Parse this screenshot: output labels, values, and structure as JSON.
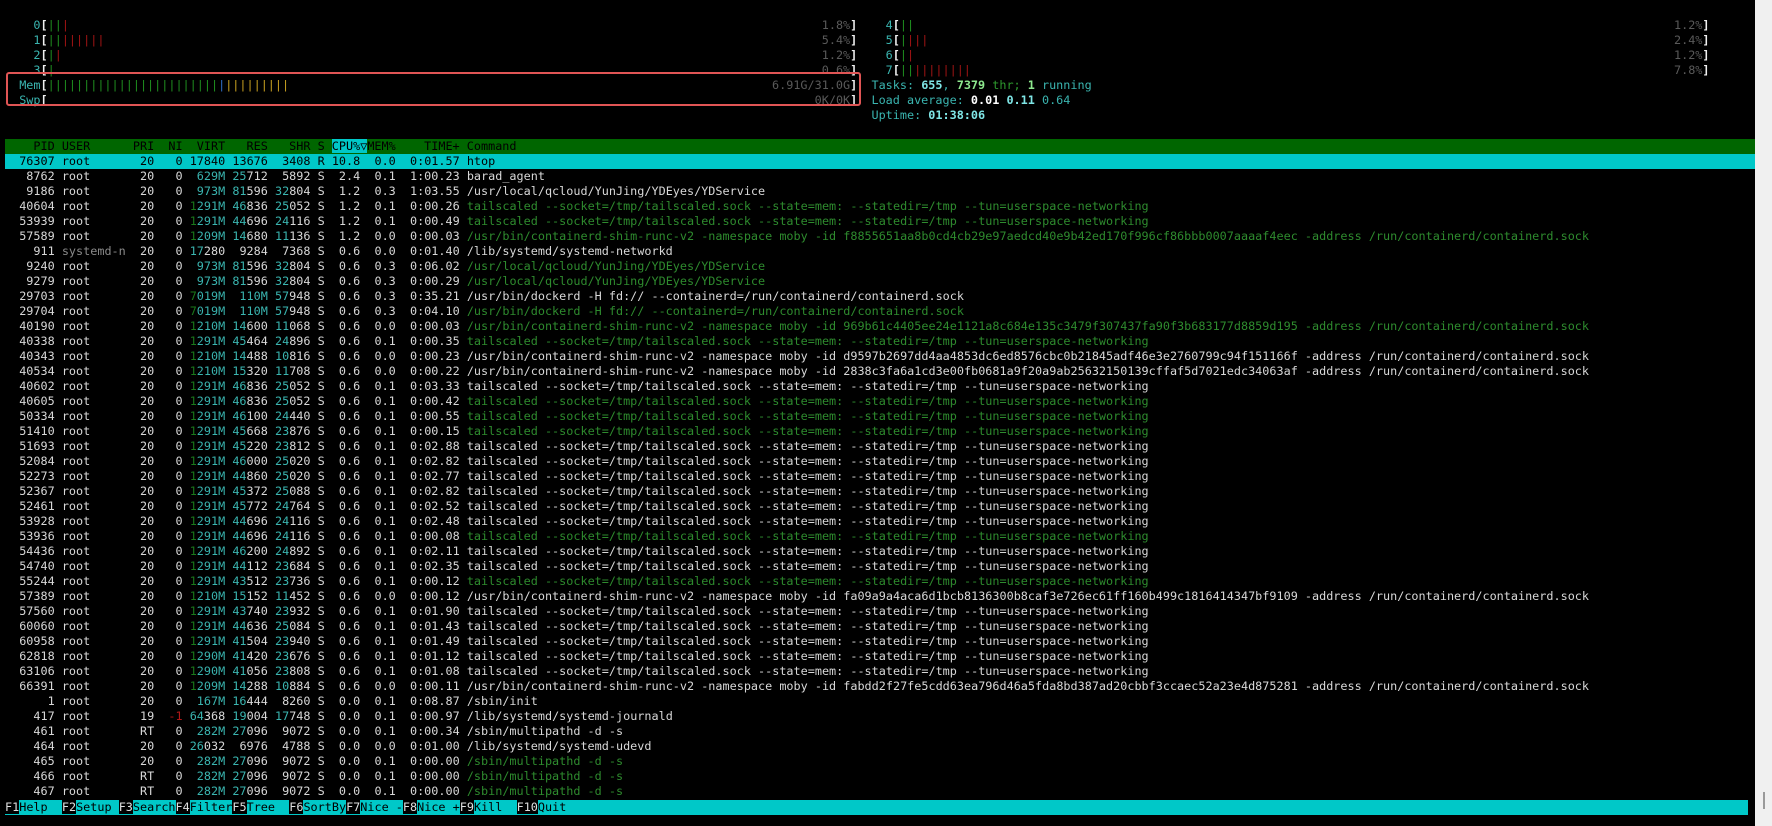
{
  "colors": {
    "header_bg": "#006600",
    "selected_bg": "#00c8c8",
    "bar_low": "#1f8f1f",
    "bar_kernel": "#a01414",
    "bar_buffers": "#3070c8",
    "bar_cache": "#c8a020",
    "thread": "#2e8b2e",
    "highlight_box": "#e05555"
  },
  "meters": {
    "left": [
      {
        "label": "0",
        "value": "1.8%",
        "percent": 1.8,
        "segments": [
          [
            "g",
            2
          ],
          [
            "r",
            1
          ]
        ]
      },
      {
        "label": "1",
        "value": "5.4%",
        "percent": 5.4,
        "segments": [
          [
            "g",
            2
          ],
          [
            "r",
            6
          ]
        ]
      },
      {
        "label": "2",
        "value": "1.2%",
        "percent": 1.2,
        "segments": [
          [
            "g",
            1
          ],
          [
            "r",
            1
          ]
        ]
      },
      {
        "label": "3",
        "value": "0.6%",
        "percent": 0.6,
        "segments": [
          [
            "g",
            1
          ]
        ]
      },
      {
        "label": "Mem",
        "value": "6.91G/31.0G",
        "segments": [
          [
            "g",
            24
          ],
          [
            "b",
            1
          ],
          [
            "y",
            9
          ]
        ]
      },
      {
        "label": "Swp",
        "value": "0K/0K",
        "segments": []
      }
    ],
    "right": [
      {
        "label": "4",
        "value": "1.2%",
        "percent": 1.2,
        "segments": [
          [
            "g",
            2
          ]
        ]
      },
      {
        "label": "5",
        "value": "2.4%",
        "percent": 2.4,
        "segments": [
          [
            "g",
            1
          ],
          [
            "r",
            3
          ]
        ]
      },
      {
        "label": "6",
        "value": "1.2%",
        "percent": 1.2,
        "segments": [
          [
            "g",
            1
          ],
          [
            "r",
            1
          ]
        ]
      },
      {
        "label": "7",
        "value": "7.8%",
        "percent": 7.8,
        "segments": [
          [
            "g",
            2
          ],
          [
            "r",
            8
          ]
        ]
      }
    ]
  },
  "summary": {
    "tasks_label": "Tasks: ",
    "tasks": "655",
    "sep": ", ",
    "threads": "7379",
    "thr_label": " thr; ",
    "running": "1",
    "running_label": " running",
    "load_label": "Load average: ",
    "load1": "0.01",
    "load5": "0.11",
    "load15": "0.64",
    "uptime_label": "Uptime: ",
    "uptime": "01:38:06"
  },
  "table": {
    "columns": [
      "PID",
      "USER",
      "PRI",
      "NI",
      "VIRT",
      "RES",
      "SHR",
      "S",
      "CPU%▽",
      "MEM%",
      "TIME+",
      "Command"
    ],
    "sort_column": "CPU%▽",
    "selected_pid": "76307",
    "rows": [
      [
        "76307",
        "root",
        "20",
        "0",
        "17840",
        "13676",
        "3408",
        "R",
        "10.8",
        "0.0",
        "0:01.57",
        "htop",
        false
      ],
      [
        "8762",
        "root",
        "20",
        "0",
        "629M",
        "25712",
        "5892",
        "S",
        "2.4",
        "0.1",
        "1:00.23",
        "barad_agent",
        false
      ],
      [
        "9186",
        "root",
        "20",
        "0",
        "973M",
        "81596",
        "32804",
        "S",
        "1.2",
        "0.3",
        "1:03.55",
        "/usr/local/qcloud/YunJing/YDEyes/YDService",
        false
      ],
      [
        "40604",
        "root",
        "20",
        "0",
        "1291M",
        "46836",
        "25052",
        "S",
        "1.2",
        "0.1",
        "0:00.26",
        "tailscaled --socket=/tmp/tailscaled.sock --state=mem: --statedir=/tmp --tun=userspace-networking",
        true
      ],
      [
        "53939",
        "root",
        "20",
        "0",
        "1291M",
        "44696",
        "24116",
        "S",
        "1.2",
        "0.1",
        "0:00.49",
        "tailscaled --socket=/tmp/tailscaled.sock --state=mem: --statedir=/tmp --tun=userspace-networking",
        true
      ],
      [
        "57589",
        "root",
        "20",
        "0",
        "1209M",
        "14680",
        "11136",
        "S",
        "1.2",
        "0.0",
        "0:00.03",
        "/usr/bin/containerd-shim-runc-v2 -namespace moby -id f8855651aa8b0cd4cb29e97aedcd40e9b42ed170f996cf86bbb0007aaaaf4eec -address /run/containerd/containerd.sock",
        true
      ],
      [
        "911",
        "systemd-n",
        "20",
        "0",
        "17280",
        "9284",
        "7368",
        "S",
        "0.6",
        "0.0",
        "0:01.40",
        "/lib/systemd/systemd-networkd",
        false
      ],
      [
        "9240",
        "root",
        "20",
        "0",
        "973M",
        "81596",
        "32804",
        "S",
        "0.6",
        "0.3",
        "0:06.02",
        "/usr/local/qcloud/YunJing/YDEyes/YDService",
        true
      ],
      [
        "9279",
        "root",
        "20",
        "0",
        "973M",
        "81596",
        "32804",
        "S",
        "0.6",
        "0.3",
        "0:00.29",
        "/usr/local/qcloud/YunJing/YDEyes/YDService",
        true
      ],
      [
        "29703",
        "root",
        "20",
        "0",
        "7019M",
        "110M",
        "57948",
        "S",
        "0.6",
        "0.3",
        "0:35.21",
        "/usr/bin/dockerd -H fd:// --containerd=/run/containerd/containerd.sock",
        false
      ],
      [
        "29704",
        "root",
        "20",
        "0",
        "7019M",
        "110M",
        "57948",
        "S",
        "0.6",
        "0.3",
        "0:04.10",
        "/usr/bin/dockerd -H fd:// --containerd=/run/containerd/containerd.sock",
        true
      ],
      [
        "40190",
        "root",
        "20",
        "0",
        "1210M",
        "14600",
        "11068",
        "S",
        "0.6",
        "0.0",
        "0:00.03",
        "/usr/bin/containerd-shim-runc-v2 -namespace moby -id 969b61c4405ee24e1121a8c684e135c3479f307437fa90f3b683177d8859d195 -address /run/containerd/containerd.sock",
        true
      ],
      [
        "40338",
        "root",
        "20",
        "0",
        "1291M",
        "45464",
        "24896",
        "S",
        "0.6",
        "0.1",
        "0:00.35",
        "tailscaled --socket=/tmp/tailscaled.sock --state=mem: --statedir=/tmp --tun=userspace-networking",
        true
      ],
      [
        "40343",
        "root",
        "20",
        "0",
        "1210M",
        "14488",
        "10816",
        "S",
        "0.6",
        "0.0",
        "0:00.23",
        "/usr/bin/containerd-shim-runc-v2 -namespace moby -id d9597b2697dd4aa4853dc6ed8576cbc0b21845adf46e3e2760799c94f151166f -address /run/containerd/containerd.sock",
        false
      ],
      [
        "40534",
        "root",
        "20",
        "0",
        "1210M",
        "15320",
        "11708",
        "S",
        "0.6",
        "0.0",
        "0:00.22",
        "/usr/bin/containerd-shim-runc-v2 -namespace moby -id 2838c3fa6a1cd3e00fb0681a9f20a9ab25632150139cffaf5d7021edc34063af -address /run/containerd/containerd.sock",
        false
      ],
      [
        "40602",
        "root",
        "20",
        "0",
        "1291M",
        "46836",
        "25052",
        "S",
        "0.6",
        "0.1",
        "0:03.33",
        "tailscaled --socket=/tmp/tailscaled.sock --state=mem: --statedir=/tmp --tun=userspace-networking",
        false
      ],
      [
        "40605",
        "root",
        "20",
        "0",
        "1291M",
        "46836",
        "25052",
        "S",
        "0.6",
        "0.1",
        "0:00.42",
        "tailscaled --socket=/tmp/tailscaled.sock --state=mem: --statedir=/tmp --tun=userspace-networking",
        true
      ],
      [
        "50334",
        "root",
        "20",
        "0",
        "1291M",
        "46100",
        "24440",
        "S",
        "0.6",
        "0.1",
        "0:00.55",
        "tailscaled --socket=/tmp/tailscaled.sock --state=mem: --statedir=/tmp --tun=userspace-networking",
        true
      ],
      [
        "51410",
        "root",
        "20",
        "0",
        "1291M",
        "45668",
        "23876",
        "S",
        "0.6",
        "0.1",
        "0:00.15",
        "tailscaled --socket=/tmp/tailscaled.sock --state=mem: --statedir=/tmp --tun=userspace-networking",
        true
      ],
      [
        "51693",
        "root",
        "20",
        "0",
        "1291M",
        "45220",
        "23812",
        "S",
        "0.6",
        "0.1",
        "0:02.88",
        "tailscaled --socket=/tmp/tailscaled.sock --state=mem: --statedir=/tmp --tun=userspace-networking",
        false
      ],
      [
        "52084",
        "root",
        "20",
        "0",
        "1291M",
        "46000",
        "25020",
        "S",
        "0.6",
        "0.1",
        "0:02.82",
        "tailscaled --socket=/tmp/tailscaled.sock --state=mem: --statedir=/tmp --tun=userspace-networking",
        false
      ],
      [
        "52273",
        "root",
        "20",
        "0",
        "1291M",
        "44860",
        "25020",
        "S",
        "0.6",
        "0.1",
        "0:02.77",
        "tailscaled --socket=/tmp/tailscaled.sock --state=mem: --statedir=/tmp --tun=userspace-networking",
        false
      ],
      [
        "52367",
        "root",
        "20",
        "0",
        "1291M",
        "45372",
        "25088",
        "S",
        "0.6",
        "0.1",
        "0:02.82",
        "tailscaled --socket=/tmp/tailscaled.sock --state=mem: --statedir=/tmp --tun=userspace-networking",
        false
      ],
      [
        "52461",
        "root",
        "20",
        "0",
        "1291M",
        "45772",
        "24764",
        "S",
        "0.6",
        "0.1",
        "0:02.52",
        "tailscaled --socket=/tmp/tailscaled.sock --state=mem: --statedir=/tmp --tun=userspace-networking",
        false
      ],
      [
        "53928",
        "root",
        "20",
        "0",
        "1291M",
        "44696",
        "24116",
        "S",
        "0.6",
        "0.1",
        "0:02.48",
        "tailscaled --socket=/tmp/tailscaled.sock --state=mem: --statedir=/tmp --tun=userspace-networking",
        false
      ],
      [
        "53936",
        "root",
        "20",
        "0",
        "1291M",
        "44696",
        "24116",
        "S",
        "0.6",
        "0.1",
        "0:00.08",
        "tailscaled --socket=/tmp/tailscaled.sock --state=mem: --statedir=/tmp --tun=userspace-networking",
        true
      ],
      [
        "54436",
        "root",
        "20",
        "0",
        "1291M",
        "46200",
        "24892",
        "S",
        "0.6",
        "0.1",
        "0:02.11",
        "tailscaled --socket=/tmp/tailscaled.sock --state=mem: --statedir=/tmp --tun=userspace-networking",
        false
      ],
      [
        "54740",
        "root",
        "20",
        "0",
        "1291M",
        "44112",
        "23684",
        "S",
        "0.6",
        "0.1",
        "0:02.35",
        "tailscaled --socket=/tmp/tailscaled.sock --state=mem: --statedir=/tmp --tun=userspace-networking",
        false
      ],
      [
        "55244",
        "root",
        "20",
        "0",
        "1291M",
        "43512",
        "23736",
        "S",
        "0.6",
        "0.1",
        "0:00.12",
        "tailscaled --socket=/tmp/tailscaled.sock --state=mem: --statedir=/tmp --tun=userspace-networking",
        true
      ],
      [
        "57389",
        "root",
        "20",
        "0",
        "1210M",
        "15152",
        "11452",
        "S",
        "0.6",
        "0.0",
        "0:00.12",
        "/usr/bin/containerd-shim-runc-v2 -namespace moby -id fa09a9a4aca6d1bcb8136300b8caf3e726ec61ff160b499c1816414347bf9109 -address /run/containerd/containerd.sock",
        false
      ],
      [
        "57560",
        "root",
        "20",
        "0",
        "1291M",
        "43740",
        "23932",
        "S",
        "0.6",
        "0.1",
        "0:01.90",
        "tailscaled --socket=/tmp/tailscaled.sock --state=mem: --statedir=/tmp --tun=userspace-networking",
        false
      ],
      [
        "60060",
        "root",
        "20",
        "0",
        "1291M",
        "44636",
        "25084",
        "S",
        "0.6",
        "0.1",
        "0:01.43",
        "tailscaled --socket=/tmp/tailscaled.sock --state=mem: --statedir=/tmp --tun=userspace-networking",
        false
      ],
      [
        "60958",
        "root",
        "20",
        "0",
        "1291M",
        "41504",
        "23940",
        "S",
        "0.6",
        "0.1",
        "0:01.49",
        "tailscaled --socket=/tmp/tailscaled.sock --state=mem: --statedir=/tmp --tun=userspace-networking",
        false
      ],
      [
        "62818",
        "root",
        "20",
        "0",
        "1290M",
        "41420",
        "23676",
        "S",
        "0.6",
        "0.1",
        "0:01.12",
        "tailscaled --socket=/tmp/tailscaled.sock --state=mem: --statedir=/tmp --tun=userspace-networking",
        false
      ],
      [
        "63106",
        "root",
        "20",
        "0",
        "1290M",
        "41056",
        "23808",
        "S",
        "0.6",
        "0.1",
        "0:01.08",
        "tailscaled --socket=/tmp/tailscaled.sock --state=mem: --statedir=/tmp --tun=userspace-networking",
        false
      ],
      [
        "66391",
        "root",
        "20",
        "0",
        "1209M",
        "14288",
        "10884",
        "S",
        "0.6",
        "0.0",
        "0:00.11",
        "/usr/bin/containerd-shim-runc-v2 -namespace moby -id fabdd2f27fe5cdd63ea796d46a5fda8bd387ad20cbbf3ccaec52a23e4d875281 -address /run/containerd/containerd.sock",
        false
      ],
      [
        "1",
        "root",
        "20",
        "0",
        "167M",
        "16444",
        "8260",
        "S",
        "0.0",
        "0.1",
        "0:08.87",
        "/sbin/init",
        false
      ],
      [
        "417",
        "root",
        "19",
        "-1",
        "64368",
        "19004",
        "17748",
        "S",
        "0.0",
        "0.1",
        "0:00.97",
        "/lib/systemd/systemd-journald",
        false
      ],
      [
        "461",
        "root",
        "RT",
        "0",
        "282M",
        "27096",
        "9072",
        "S",
        "0.0",
        "0.1",
        "0:00.34",
        "/sbin/multipathd -d -s",
        false
      ],
      [
        "464",
        "root",
        "20",
        "0",
        "26032",
        "6976",
        "4788",
        "S",
        "0.0",
        "0.0",
        "0:01.00",
        "/lib/systemd/systemd-udevd",
        false
      ],
      [
        "465",
        "root",
        "20",
        "0",
        "282M",
        "27096",
        "9072",
        "S",
        "0.0",
        "0.1",
        "0:00.00",
        "/sbin/multipathd -d -s",
        true
      ],
      [
        "466",
        "root",
        "RT",
        "0",
        "282M",
        "27096",
        "9072",
        "S",
        "0.0",
        "0.1",
        "0:00.00",
        "/sbin/multipathd -d -s",
        true
      ],
      [
        "467",
        "root",
        "RT",
        "0",
        "282M",
        "27096",
        "9072",
        "S",
        "0.0",
        "0.1",
        "0:00.00",
        "/sbin/multipathd -d -s",
        true
      ]
    ]
  },
  "footer": [
    {
      "key": "F1",
      "label": "Help  "
    },
    {
      "key": "F2",
      "label": "Setup "
    },
    {
      "key": "F3",
      "label": "Search"
    },
    {
      "key": "F4",
      "label": "Filter"
    },
    {
      "key": "F5",
      "label": "Tree  "
    },
    {
      "key": "F6",
      "label": "SortBy"
    },
    {
      "key": "F7",
      "label": "Nice -"
    },
    {
      "key": "F8",
      "label": "Nice +"
    },
    {
      "key": "F9",
      "label": "Kill  "
    },
    {
      "key": "F10",
      "label": "Quit"
    }
  ]
}
